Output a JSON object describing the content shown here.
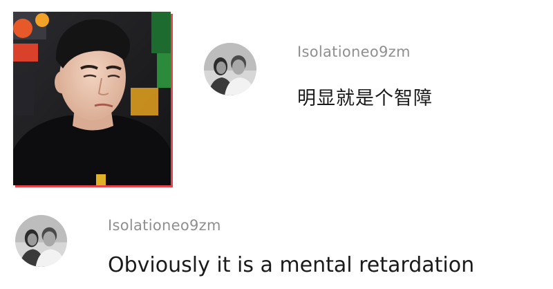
{
  "comments": [
    {
      "username": "Isolationeo9zm",
      "text": "明显就是个智障",
      "avatar_icon": "avatar-couple-photo-icon"
    },
    {
      "username": "Isolationeo9zm",
      "text": "Obviously it is a mental retardation",
      "avatar_icon": "avatar-couple-photo-icon"
    }
  ],
  "colors": {
    "frame_accent": "#e8424a",
    "username": "#8f8f8f",
    "comment_text": "#1a1a1a",
    "background": "#ffffff"
  }
}
